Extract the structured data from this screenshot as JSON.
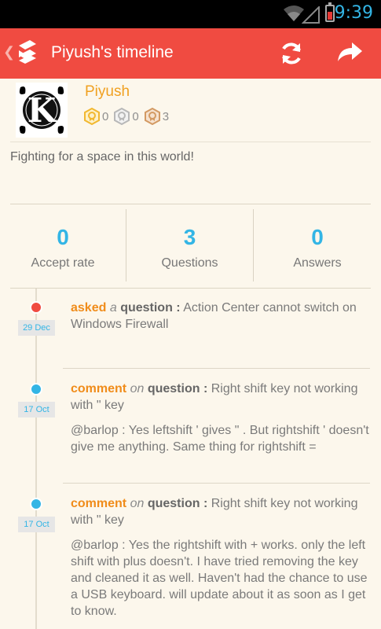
{
  "status_bar": {
    "time": "9:39"
  },
  "action_bar": {
    "title": "Piyush's timeline"
  },
  "profile": {
    "name": "Piyush",
    "avatar_letter": "K",
    "badges": {
      "gold": "0",
      "silver": "0",
      "bronze": "3"
    },
    "about": "Fighting for a space in this world!"
  },
  "stats": [
    {
      "value": "0",
      "label": "Accept rate"
    },
    {
      "value": "3",
      "label": "Questions"
    },
    {
      "value": "0",
      "label": "Answers"
    }
  ],
  "timeline": [
    {
      "date": "29 Dec",
      "verb": "asked",
      "prep": "a",
      "kind": "question :",
      "title": "Action Center cannot switch on Windows Firewall",
      "comment": ""
    },
    {
      "date": "17 Oct",
      "verb": "comment",
      "prep": "on",
      "kind": "question :",
      "title": "Right shift key not working with \" key",
      "comment": "@barlop : Yes leftshift ' gives \" . But rightshift ' doesn't give me anything. Same thing for rightshift ="
    },
    {
      "date": "17 Oct",
      "verb": "comment",
      "prep": "on",
      "kind": "question :",
      "title": "Right shift key not working with \" key",
      "comment": "@barlop : Yes the rightshift with + works. only the left shift with plus doesn't. I have tried removing the key and cleaned it as well. Haven't had the chance to use a USB keyboard. will update about it as soon as I get to know."
    }
  ],
  "colors": {
    "action_bar": "#f04b41",
    "accent": "#33b5e5",
    "username": "#f0a020",
    "verb": "#f08c1a"
  }
}
